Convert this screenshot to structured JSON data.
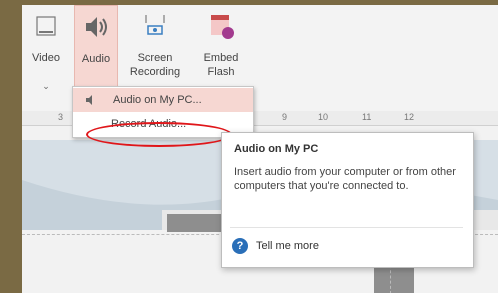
{
  "ribbon": {
    "buttons": [
      {
        "label": "Video",
        "arrow": "⌄",
        "icon": "video-icon"
      },
      {
        "label": "Audio",
        "arrow": "⌄",
        "icon": "speaker-icon"
      },
      {
        "label": "Screen Recording",
        "icon": "screen-recording-icon"
      },
      {
        "label": "Embed Flash",
        "icon": "flash-icon"
      }
    ]
  },
  "ruler": {
    "ticks": [
      "3",
      "9",
      "10",
      "11",
      "12"
    ]
  },
  "audio_menu": {
    "items": [
      {
        "label": "Audio on My PC...",
        "icon": "speaker-small-icon"
      },
      {
        "label": "Record Audio..."
      }
    ]
  },
  "tooltip": {
    "title": "Audio on My PC",
    "body": "Insert audio from your computer or from other computers that you're connected to.",
    "link": "Tell me more",
    "link_icon": "help-icon"
  },
  "colors": {
    "frame": "#7a6a44",
    "audio_selected": "#f6d7d2",
    "highlight_oval": "#e0161a",
    "help_icon": "#2a6fb8"
  }
}
